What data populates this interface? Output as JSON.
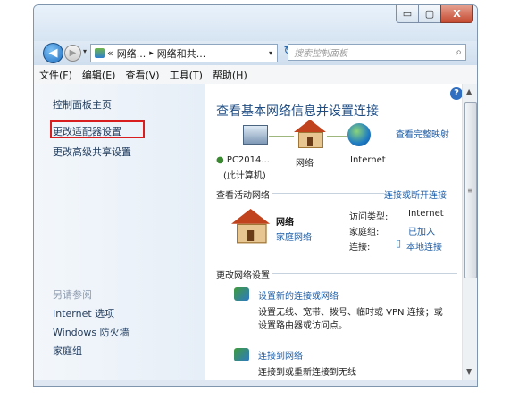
{
  "window": {
    "controls": {
      "minimize": "▭",
      "maximize": "▢",
      "close": "X"
    }
  },
  "nav": {
    "back_glyph": "◀",
    "forward_glyph": "▶",
    "history_glyph": "▾",
    "address_prefix": "«",
    "address_seg1": "网络...",
    "address_sep": "▸",
    "address_seg2": "网络和共...",
    "address_arrow": "▾",
    "refresh_glyph": "↻",
    "search_placeholder": "搜索控制面板",
    "search_icon": "⌕"
  },
  "menu": [
    "文件(F)",
    "编辑(E)",
    "查看(V)",
    "工具(T)",
    "帮助(H)"
  ],
  "sidebar": {
    "home": "控制面板主页",
    "adapter": "更改适配器设置",
    "sharing": "更改高级共享设置",
    "see_also": "另请参阅",
    "links": [
      "Internet 选项",
      "Windows 防火墙",
      "家庭组"
    ]
  },
  "main": {
    "help_glyph": "?",
    "title": "查看基本网络信息并设置连接",
    "full_map": "查看完整映射",
    "map": {
      "pc_name": "PC2014...",
      "pc_sub": "(此计算机)",
      "network": "网络",
      "internet": "Internet"
    },
    "active_header": "查看活动网络",
    "connect_disconnect": "连接或断开连接",
    "network": {
      "name": "网络",
      "type": "家庭网络",
      "access_label": "访问类型:",
      "access_value": "Internet",
      "homegroup_label": "家庭组:",
      "homegroup_value": "已加入",
      "connection_label": "连接:",
      "connection_value": "本地连接"
    },
    "change_header": "更改网络设置",
    "items": [
      {
        "link": "设置新的连接或网络",
        "desc1": "设置无线、宽带、拨号、临时或 VPN 连接；或",
        "desc2": "设置路由器或访问点。"
      },
      {
        "link": "连接到网络",
        "desc1": "连接到或重新连接到无线"
      }
    ]
  },
  "scrollbar": {
    "up": "▲",
    "down": "▼",
    "mark": "≡"
  },
  "colors": {
    "highlight_box": "#d81e1e",
    "link": "#1c5ea8",
    "title": "#1e4c83"
  }
}
